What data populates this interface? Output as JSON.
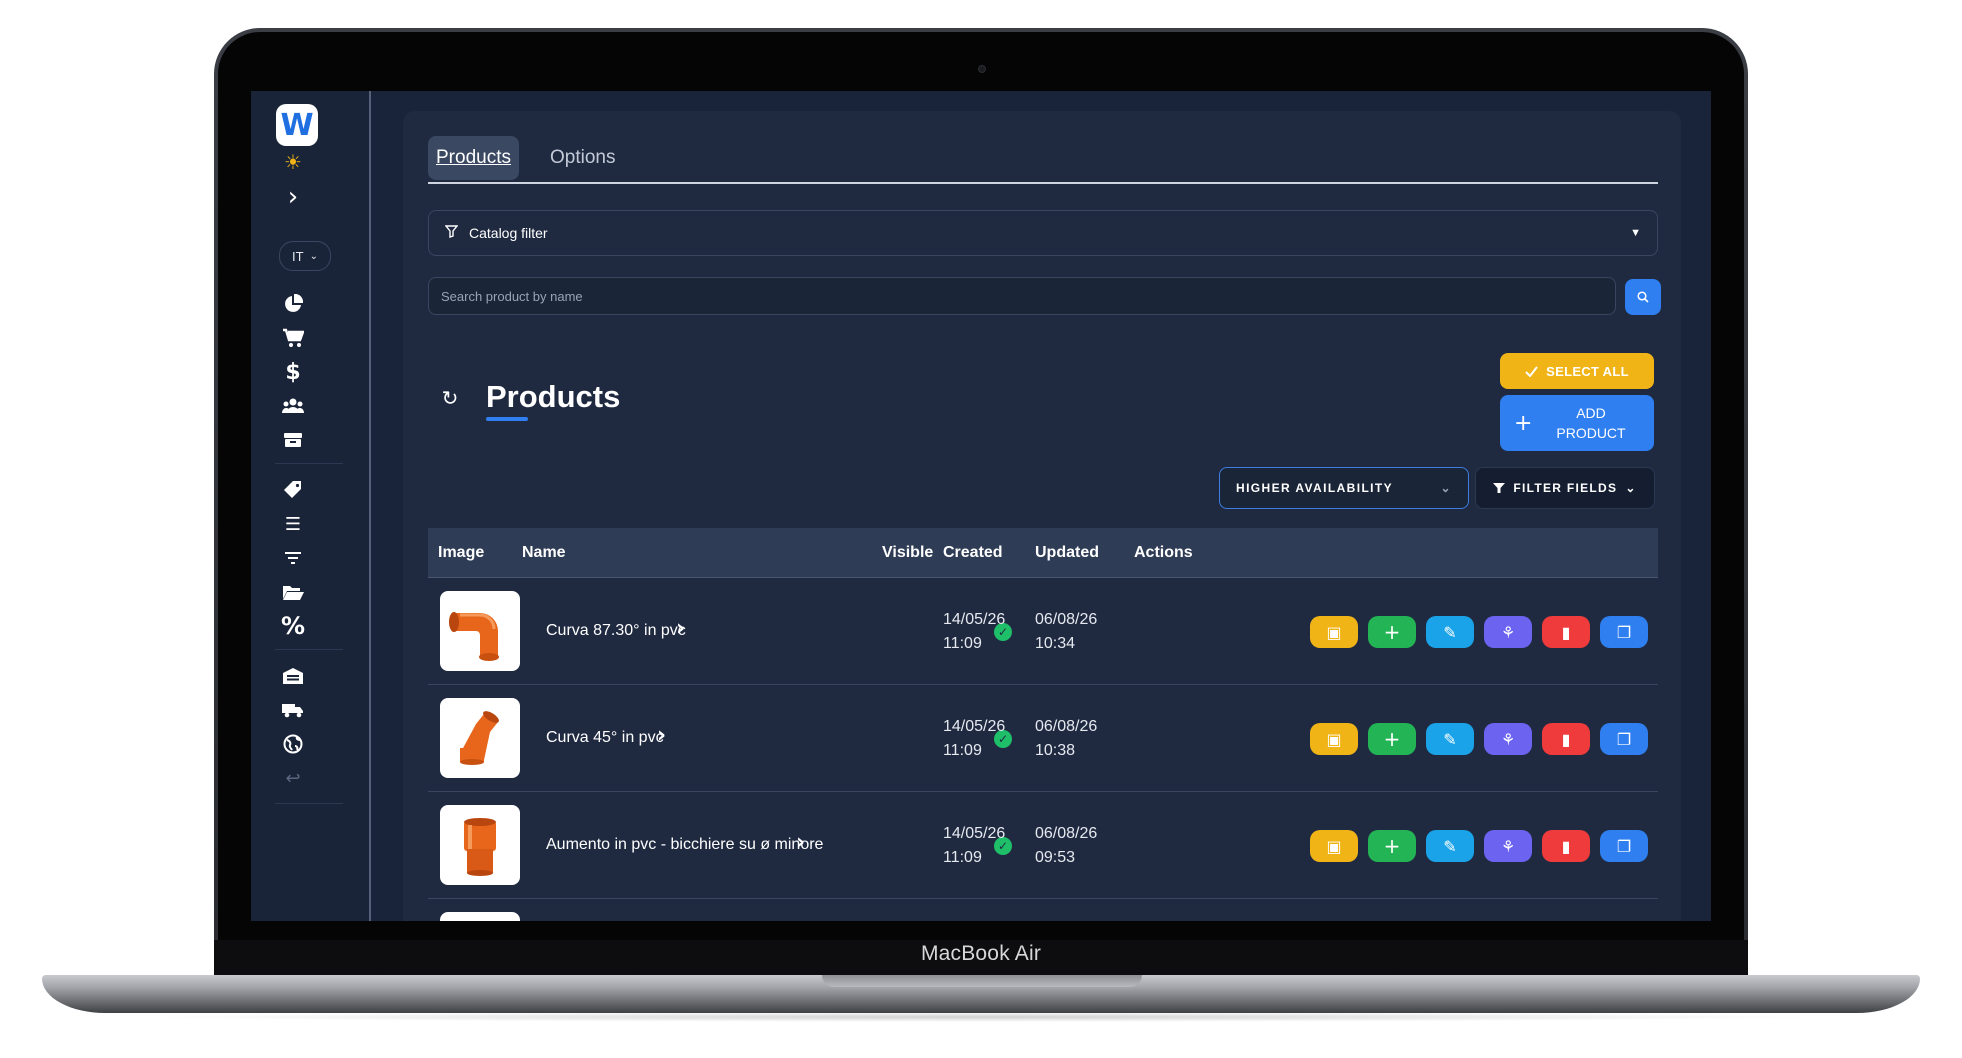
{
  "device": {
    "brand_label": "MacBook Air"
  },
  "sidebar": {
    "logo_letter": "W",
    "language": "IT",
    "icons": [
      "sun-icon",
      "chevron-right-icon",
      "pie-chart-icon",
      "cart-icon",
      "dollar-icon",
      "users-icon",
      "box-icon",
      "tag-icon",
      "list-ordered-icon",
      "filter-lines-icon",
      "folder-open-icon",
      "percent-icon",
      "warehouse-icon",
      "truck-icon",
      "globe-icon",
      "return-icon"
    ]
  },
  "tabs": [
    {
      "label": "Products",
      "active": true
    },
    {
      "label": "Options",
      "active": false
    }
  ],
  "catalog_filter": {
    "label": "Catalog filter"
  },
  "search": {
    "placeholder": "Search product by name"
  },
  "header": {
    "title": "Products",
    "select_all": "SELECT ALL",
    "add_product": "ADD\nPRODUCT",
    "sort": "HIGHER AVAILABILITY",
    "filter_fields": "FILTER FIELDS"
  },
  "table": {
    "columns": [
      "Image",
      "Name",
      "Visible",
      "Created",
      "Updated",
      "Actions"
    ],
    "rows": [
      {
        "name": "Curva 87.30° in pvc",
        "visible": true,
        "created_date": "14/05/26",
        "created_time": "11:09",
        "updated_date": "06/08/26",
        "updated_time": "10:34",
        "image": "elbow-87-pipe"
      },
      {
        "name": "Curva 45° in pvc",
        "visible": true,
        "created_date": "14/05/26",
        "created_time": "11:09",
        "updated_date": "06/08/26",
        "updated_time": "10:38",
        "image": "elbow-45-pipe"
      },
      {
        "name": "Aumento in pvc - bicchiere su ø minore",
        "visible": true,
        "created_date": "14/05/26",
        "created_time": "11:09",
        "updated_date": "06/08/26",
        "updated_time": "09:53",
        "image": "reducer-pipe"
      }
    ]
  },
  "colors": {
    "accent_blue": "#2f7ff0",
    "select_all_yellow": "#f0b416",
    "action_gallery": "#f0b416",
    "action_add": "#22b455",
    "action_edit": "#1aa3e8",
    "action_share": "#6c63f0",
    "action_delete": "#ef3b3b",
    "action_copy": "#2f7ff0",
    "visible_green": "#1fbf6a"
  }
}
